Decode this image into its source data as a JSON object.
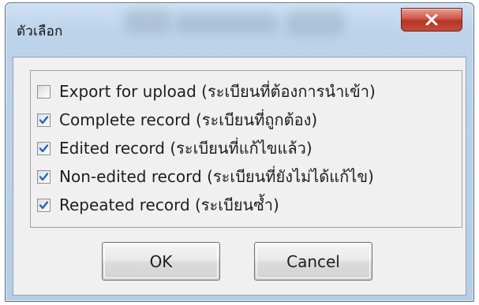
{
  "dialog": {
    "title": "ตัวเลือก",
    "close_glyph": "x",
    "options": [
      {
        "label": "Export for upload (ระเบียนที่ต้องการนำเข้า)",
        "checked": false
      },
      {
        "label": "Complete record (ระเบียนที่ถูกต้อง)",
        "checked": true
      },
      {
        "label": "Edited record (ระเบียนที่แก้ไขแล้ว)",
        "checked": true
      },
      {
        "label": "Non-edited record (ระเบียนที่ยังไม่ได้แก้ไข)",
        "checked": true
      },
      {
        "label": "Repeated record (ระเบียนซ้ำ)",
        "checked": true
      }
    ],
    "ok_label": "OK",
    "cancel_label": "Cancel"
  },
  "colors": {
    "close_button": "#c54a3a",
    "check_mark": "#2a64b8",
    "client_bg": "#f0f0f0"
  }
}
